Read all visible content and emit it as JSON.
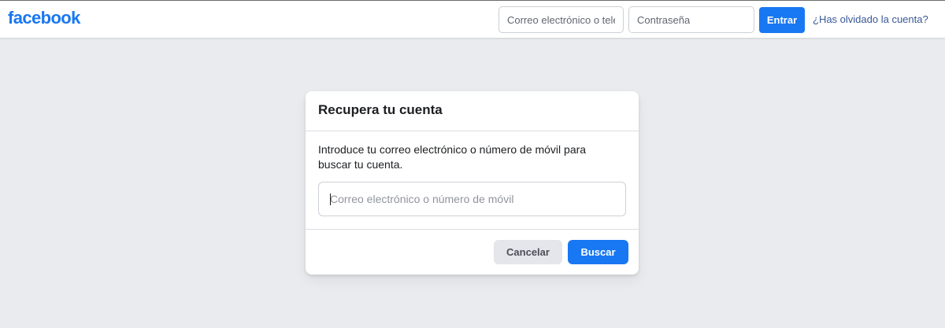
{
  "header": {
    "logo": "facebook",
    "email_placeholder": "Correo electrónico o teléfono",
    "password_placeholder": "Contraseña",
    "enter_label": "Entrar",
    "forgot_label": "¿Has olvidado la cuenta?"
  },
  "recover": {
    "title": "Recupera tu cuenta",
    "description": "Introduce tu correo electrónico o número de móvil para buscar tu cuenta.",
    "input_placeholder": "Correo electrónico o número de móvil",
    "cancel_label": "Cancelar",
    "search_label": "Buscar"
  },
  "colors": {
    "brand": "#1877f2",
    "background": "#e9ebee",
    "link": "#385898"
  }
}
